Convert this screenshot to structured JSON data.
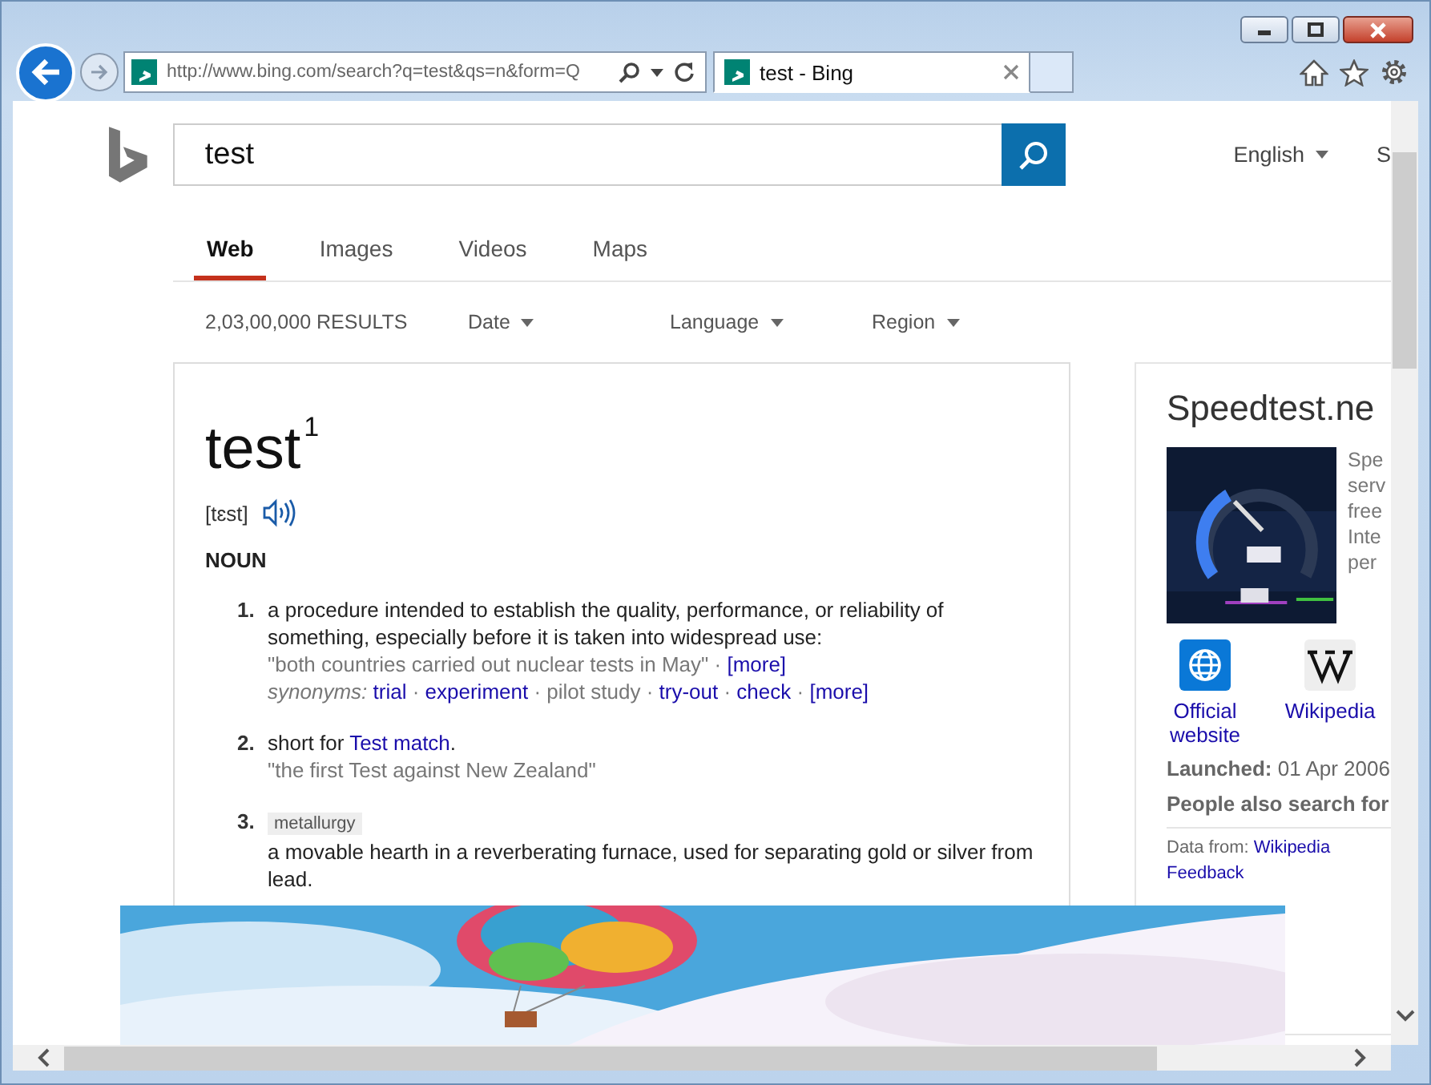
{
  "browser": {
    "address": "http://www.bing.com/search?q=test&qs=n&form=Q",
    "tab": {
      "title": "test - Bing",
      "selected": true
    },
    "forward_disabled": true
  },
  "header": {
    "query": "test",
    "language": "English",
    "cut_item": "S"
  },
  "tabs": [
    {
      "label": "Web",
      "selected": true
    },
    {
      "label": "Images",
      "selected": false
    },
    {
      "label": "Videos",
      "selected": false
    },
    {
      "label": "Maps",
      "selected": false
    }
  ],
  "results": {
    "count": "2,03,00,000 RESULTS",
    "filters": [
      "Date",
      "Language",
      "Region"
    ]
  },
  "definition": {
    "headword": "test$^{1}$",
    "pronunciation": "[tɛst]",
    "part_of_speech": "NOUN",
    "separator": "·",
    "senses": [
      {
        "number": "1.",
        "text": [
          {
            "text": "a procedure intended to establish the quality, performance, or reliability of something, especially before it is taken into widespread use:",
            "link": false
          }
        ],
        "example": "\"both countries carried out nuclear tests in May\"",
        "example_more": "[more]",
        "synonyms_label": "synonyms:",
        "synonyms": [
          {
            "text": "trial",
            "link": true
          },
          {
            "text": "experiment",
            "link": true
          },
          {
            "text": "pilot study",
            "link": false
          },
          {
            "text": "try-out",
            "link": true
          },
          {
            "text": "check",
            "link": true
          },
          {
            "text": "[more]",
            "link": true
          }
        ]
      },
      {
        "number": "2.",
        "text": [
          {
            "text": "short for ",
            "link": false
          },
          {
            "text": "Test match",
            "link": true
          },
          {
            "text": ".",
            "link": false
          }
        ],
        "example": "\"the first Test against New Zealand\""
      },
      {
        "number": "3.",
        "label": "metallurgy",
        "text": [
          {
            "text": "a movable hearth in a reverberating furnace, used for separating gold or silver from lead.",
            "link": false
          }
        ]
      }
    ]
  },
  "entity": {
    "title": "Speedtest.ne",
    "description_lines": [
      "Spe",
      "serv",
      "free",
      "Inte",
      "per"
    ],
    "links": [
      {
        "kind": "globe",
        "label": "Official website"
      },
      {
        "kind": "wiki",
        "label": "Wikipedia"
      }
    ],
    "launched": "**Launched:** 01 Apr 2006",
    "people_also": "People also search for",
    "data_from": "Data from:",
    "data_source": "Wikipedia",
    "feedback": "Feedback"
  }
}
